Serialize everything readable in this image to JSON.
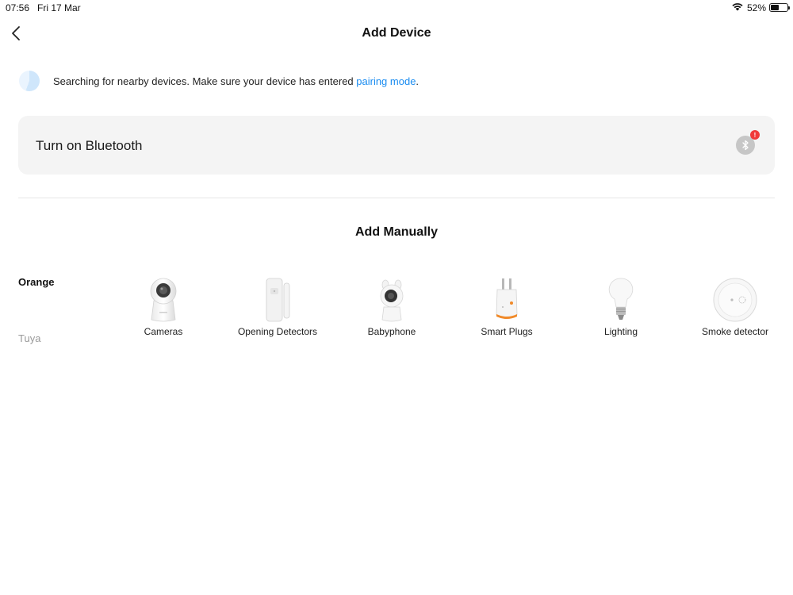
{
  "status_bar": {
    "time": "07:56",
    "date": "Fri 17 Mar",
    "battery": "52%",
    "battery_level": 0.52
  },
  "header": {
    "title": "Add Device",
    "back_icon": "chevron-left-icon"
  },
  "search": {
    "text": "Searching for nearby devices. Make sure your device has entered ",
    "link": "pairing mode",
    "suffix": "."
  },
  "bluetooth": {
    "label": "Turn on Bluetooth",
    "icon": "bluetooth-icon",
    "badge": "!"
  },
  "manual": {
    "title": "Add Manually"
  },
  "brands": [
    {
      "label": "Orange",
      "active": true
    },
    {
      "label": "Tuya",
      "active": false
    }
  ],
  "categories": [
    {
      "label": "Cameras",
      "icon": "camera-device-icon"
    },
    {
      "label": "Opening Detectors",
      "icon": "door-sensor-icon"
    },
    {
      "label": "Babyphone",
      "icon": "baby-monitor-icon"
    },
    {
      "label": "Smart Plugs",
      "icon": "smart-plug-icon"
    },
    {
      "label": "Lighting",
      "icon": "light-bulb-icon"
    },
    {
      "label": "Smoke detector",
      "icon": "smoke-detector-icon"
    }
  ],
  "colors": {
    "accent": "#1a8cf0",
    "card_bg": "#f4f4f4",
    "badge": "#f03a3a"
  }
}
